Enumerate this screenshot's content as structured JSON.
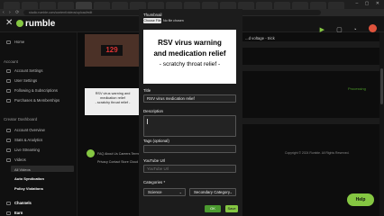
{
  "browser": {
    "url": "studio.rumble.com/content/videos/upload/edit",
    "window_buttons": "– ▢ ✕",
    "nav": "‹ › ⟳"
  },
  "header": {
    "brand": "rumble"
  },
  "sidebar": {
    "home": "Home",
    "account_head": "Account",
    "account_settings": "Account Settings",
    "user_settings": "User Settings",
    "following": "Following & Subscriptions",
    "purchases": "Purchases & Memberships",
    "creator_head": "Creator Dashboard",
    "account_overview": "Account Overview",
    "stats": "Stats & Analytics",
    "live_streaming": "Live Streaming",
    "videos": "Videos",
    "all_videos": "All Videos",
    "auto_syndication": "Auto Syndication",
    "policy_violations": "Policy Violations",
    "channels": "Channels",
    "earn": "Earn"
  },
  "background": {
    "row1_title": "...d voltage - trick",
    "digits": "129",
    "thumb2_l1": "RSV virus warning and",
    "thumb2_l2": "medication relief",
    "thumb2_l3": "- scratchy throat relief -",
    "green_text": "Processing",
    "footer_links": "FAQ About Us Careers Terms Privacy Contact Store Cloud",
    "footer_right": "Copyright © 2024 Rumble. All Rights Reserved."
  },
  "modal": {
    "thumbnail_label": "Thumbnail",
    "choose_file": "Choose File",
    "no_file": "No file chosen",
    "preview_l1": "RSV virus warning",
    "preview_l2": "and medication relief",
    "preview_l3": "- scratchy throat relief -",
    "title_label": "Title",
    "title_value": "RSV virus medication relief",
    "description_label": "Description",
    "tags_label": "Tags (optional)",
    "youtube_label": "YouTube Url",
    "youtube_placeholder": "YouTube Url",
    "categories_label": "Categories *",
    "category_primary": "Science",
    "category_secondary": "Secondary Category",
    "ok_button": "OK",
    "save_button": "Save"
  },
  "help": {
    "label": "Help"
  }
}
